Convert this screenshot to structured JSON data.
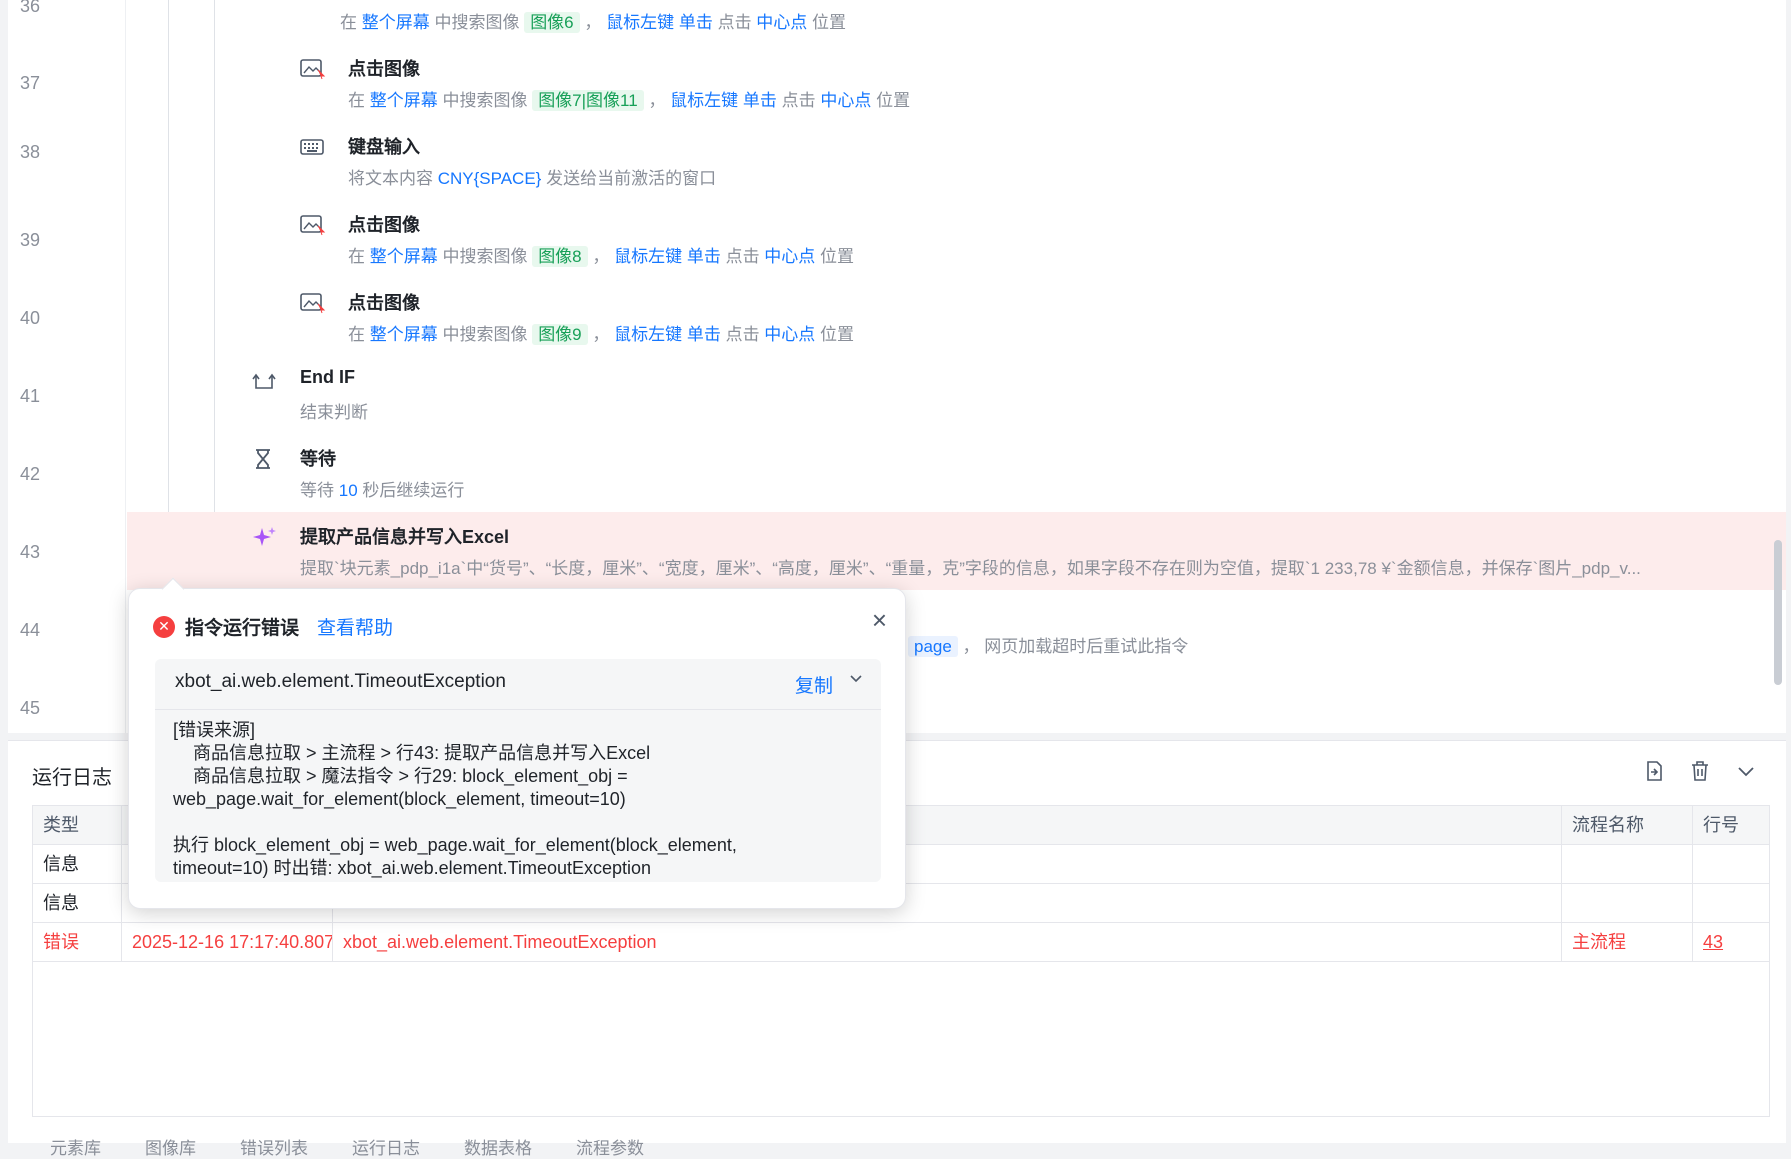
{
  "editor": {
    "line_numbers": [
      "36",
      "37",
      "38",
      "39",
      "40",
      "41",
      "42",
      "43",
      "44",
      "45"
    ],
    "steps": [
      {
        "title": "",
        "desc_parts": [
          {
            "t": "在 ",
            "c": ""
          },
          {
            "t": "整个屏幕",
            "c": "kw"
          },
          {
            "t": " 中搜索图像 ",
            "c": ""
          },
          {
            "t": "图像6",
            "c": "tag"
          },
          {
            "t": " ， ",
            "c": ""
          },
          {
            "t": "鼠标左键",
            "c": "kw"
          },
          {
            "t": " ",
            "c": ""
          },
          {
            "t": "单击",
            "c": "kw"
          },
          {
            "t": " 点击 ",
            "c": ""
          },
          {
            "t": "中心点",
            "c": "kw"
          },
          {
            "t": " 位置",
            "c": ""
          }
        ]
      },
      {
        "title": "点击图像",
        "desc_parts": [
          {
            "t": "在 ",
            "c": ""
          },
          {
            "t": "整个屏幕",
            "c": "kw"
          },
          {
            "t": " 中搜索图像 ",
            "c": ""
          },
          {
            "t": "图像7|图像11",
            "c": "tag"
          },
          {
            "t": " ， ",
            "c": ""
          },
          {
            "t": "鼠标左键",
            "c": "kw"
          },
          {
            "t": " ",
            "c": ""
          },
          {
            "t": "单击",
            "c": "kw"
          },
          {
            "t": " 点击 ",
            "c": ""
          },
          {
            "t": "中心点",
            "c": "kw"
          },
          {
            "t": " 位置",
            "c": ""
          }
        ]
      },
      {
        "title": "键盘输入",
        "desc_parts": [
          {
            "t": "将文本内容 ",
            "c": ""
          },
          {
            "t": "CNY{SPACE}",
            "c": "kw"
          },
          {
            "t": " 发送给当前激活的窗口",
            "c": ""
          }
        ]
      },
      {
        "title": "点击图像",
        "desc_parts": [
          {
            "t": "在 ",
            "c": ""
          },
          {
            "t": "整个屏幕",
            "c": "kw"
          },
          {
            "t": " 中搜索图像 ",
            "c": ""
          },
          {
            "t": "图像8",
            "c": "tag"
          },
          {
            "t": " ， ",
            "c": ""
          },
          {
            "t": "鼠标左键",
            "c": "kw"
          },
          {
            "t": " ",
            "c": ""
          },
          {
            "t": "单击",
            "c": "kw"
          },
          {
            "t": " 点击 ",
            "c": ""
          },
          {
            "t": "中心点",
            "c": "kw"
          },
          {
            "t": " 位置",
            "c": ""
          }
        ]
      },
      {
        "title": "点击图像",
        "desc_parts": [
          {
            "t": "在 ",
            "c": ""
          },
          {
            "t": "整个屏幕",
            "c": "kw"
          },
          {
            "t": " 中搜索图像 ",
            "c": ""
          },
          {
            "t": "图像9",
            "c": "tag"
          },
          {
            "t": " ， ",
            "c": ""
          },
          {
            "t": "鼠标左键",
            "c": "kw"
          },
          {
            "t": " ",
            "c": ""
          },
          {
            "t": "单击",
            "c": "kw"
          },
          {
            "t": " 点击 ",
            "c": ""
          },
          {
            "t": "中心点",
            "c": "kw"
          },
          {
            "t": " 位置",
            "c": ""
          }
        ]
      },
      {
        "title": "End IF",
        "desc_parts": [
          {
            "t": "结束判断",
            "c": ""
          }
        ]
      },
      {
        "title": "等待",
        "desc_parts": [
          {
            "t": "等待 ",
            "c": ""
          },
          {
            "t": "10",
            "c": "kw"
          },
          {
            "t": " 秒后继续运行",
            "c": ""
          }
        ]
      },
      {
        "title": "提取产品信息并写入Excel",
        "desc_parts": [
          {
            "t": "提取`块元素_pdp_i1a`中“货号”、“长度，厘米”、“宽度，厘米”、“高度，厘米”、“重量，克”字段的信息，如果字段不存在则为空值，提取`1 233,78 ¥`金额信息，并保存`图片_pdp_v...",
            "c": ""
          }
        ]
      },
      {
        "title": "",
        "desc_parts": [
          {
            "t": "page",
            "c": "tag-blue"
          },
          {
            "t": " ， 网页加载超时后重试此指令",
            "c": ""
          }
        ]
      }
    ]
  },
  "popover": {
    "title": "指令运行错误",
    "help_link": "查看帮助",
    "close": "×",
    "exception": "xbot_ai.web.element.TimeoutException",
    "copy_label": "复制",
    "detail": "[错误来源]\n    商品信息拉取 > 主流程 > 行43: 提取产品信息并写入Excel\n    商品信息拉取 > 魔法指令 > 行29: block_element_obj =\nweb_page.wait_for_element(block_element, timeout=10)\n\n执行 block_element_obj = web_page.wait_for_element(block_element,\ntimeout=10) 时出错: xbot_ai.web.element.TimeoutException"
  },
  "log": {
    "title": "运行日志",
    "columns": [
      "类型",
      "",
      "",
      "流程名称",
      "行号"
    ],
    "rows": [
      {
        "type": "信息",
        "time": "",
        "message": "",
        "flow": "",
        "line": ""
      },
      {
        "type": "信息",
        "time": "",
        "message": "",
        "flow": "",
        "line": ""
      },
      {
        "type": "错误",
        "time": "2025-12-16 17:17:40.807",
        "message": "xbot_ai.web.element.TimeoutException",
        "flow": "主流程",
        "line": "43"
      }
    ],
    "bottom_tabs": [
      "元素库",
      "图像库",
      "错误列表",
      "运行日志",
      "数据表格",
      "流程参数"
    ]
  }
}
